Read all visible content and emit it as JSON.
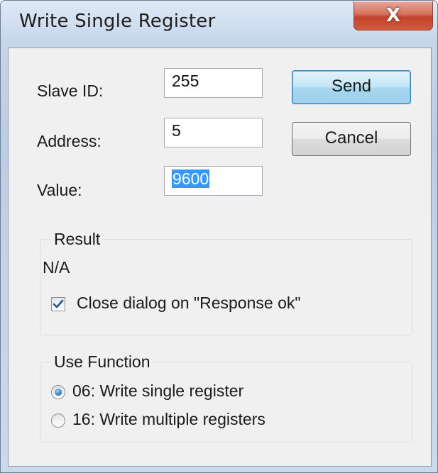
{
  "window": {
    "title": "Write Single Register",
    "close_glyph": "X"
  },
  "form": {
    "slave_id_label": "Slave ID:",
    "slave_id_value": "255",
    "address_label": "Address:",
    "address_value": "5",
    "value_label": "Value:",
    "value_value": "9600"
  },
  "buttons": {
    "send": "Send",
    "cancel": "Cancel"
  },
  "result": {
    "group_title": "Result",
    "status": "N/A",
    "close_on_ok_label": "Close dialog on \"Response ok\"",
    "close_on_ok_checked": true
  },
  "use_function": {
    "group_title": "Use Function",
    "options": [
      {
        "label": "06: Write single register",
        "selected": true
      },
      {
        "label": "16: Write multiple registers",
        "selected": false
      }
    ]
  },
  "colors": {
    "title_bar": "#c5d6ea",
    "close_button": "#c3432b",
    "selection": "#3399ff",
    "default_button_border": "#3c7fb1"
  }
}
